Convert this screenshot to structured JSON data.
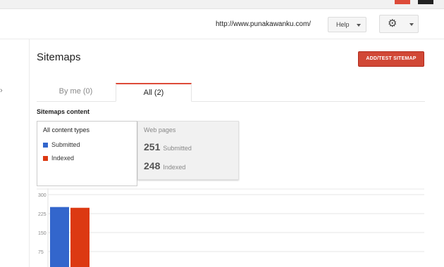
{
  "header": {
    "site_url": "http://www.punakawanku.com/",
    "help_label": "Help"
  },
  "page": {
    "title": "Sitemaps",
    "add_button": "ADD/TEST SITEMAP",
    "tabs": [
      {
        "label": "By me (0)",
        "active": false
      },
      {
        "label": "All (2)",
        "active": true
      }
    ],
    "section_title": "Sitemaps content"
  },
  "legend": {
    "heading": "All content types",
    "items": [
      {
        "label": "Submitted",
        "color": "#3366cc"
      },
      {
        "label": "Indexed",
        "color": "#dc3912"
      }
    ]
  },
  "stats": {
    "heading": "Web pages",
    "rows": [
      {
        "value": "251",
        "label": "Submitted"
      },
      {
        "value": "248",
        "label": "Indexed"
      }
    ]
  },
  "colors": {
    "accent_red": "#dd4b39",
    "submitted": "#3366cc",
    "indexed": "#dc3912"
  },
  "icons": {
    "settings": "gear-icon",
    "dropdown": "chevron-down-icon"
  },
  "chart_data": {
    "type": "bar",
    "categories": [
      ""
    ],
    "series": [
      {
        "name": "Submitted",
        "values": [
          251
        ],
        "color": "#3366cc"
      },
      {
        "name": "Indexed",
        "values": [
          248
        ],
        "color": "#dc3912"
      }
    ],
    "yticks": [
      300,
      225,
      150,
      75
    ],
    "ylim": [
      0,
      300
    ],
    "grid": true
  }
}
